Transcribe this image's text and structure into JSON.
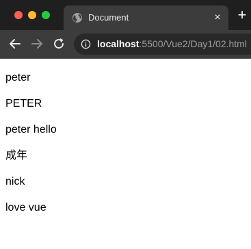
{
  "tab": {
    "title": "Document",
    "close_glyph": "×",
    "icon": "globe-icon"
  },
  "new_tab_glyph": "+",
  "toolbar": {
    "url_host": "localhost",
    "url_rest": ":5500/Vue2/Day1/02.html"
  },
  "page": {
    "lines": [
      "peter",
      "PETER",
      "peter hello",
      "成年",
      "nick",
      "love vue"
    ]
  },
  "colors": {
    "tabstrip": "#1f1f1f",
    "toolbar": "#3c3c3c",
    "omnibox": "#282828",
    "close": "#fe5f57",
    "minimize": "#febc2e",
    "maximize": "#28c840"
  }
}
